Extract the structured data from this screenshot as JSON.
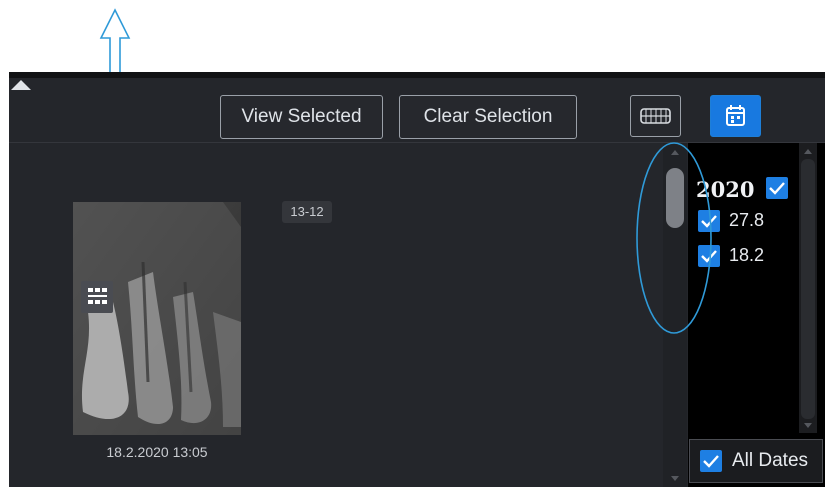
{
  "toolbar": {
    "view_selected_label": "View Selected",
    "clear_selection_label": "Clear Selection",
    "dentition_icon": "dentition-icon",
    "calendar_icon": "calendar-icon",
    "collapse_icon": "chevron-up-icon"
  },
  "thumbnail": {
    "caption": "18.2.2020 13:05",
    "tooth_tag": "13-12",
    "badge_icon": "grid-icon"
  },
  "date_filter": {
    "year": "2020",
    "dates": [
      "27.8",
      "18.2"
    ],
    "all_dates_label": "All Dates"
  },
  "colors": {
    "accent": "#1e7fe3",
    "panel_bg": "#24262b",
    "annotation": "#2f9ad8"
  }
}
